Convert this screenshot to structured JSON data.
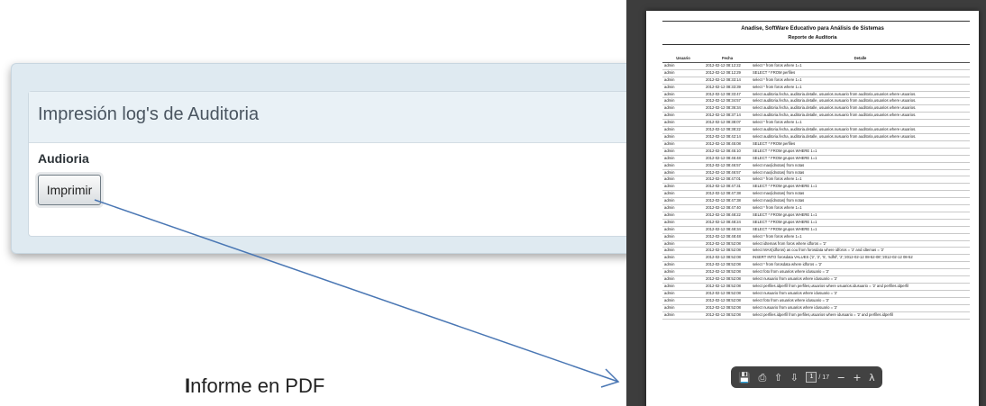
{
  "app": {
    "title": "Impresión log's de Auditoria",
    "section_label": "Audioria",
    "print_button": "Imprimir"
  },
  "caption": {
    "first_letter": "I",
    "rest": "nforme en PDF"
  },
  "pdf": {
    "title": "Anadise, SoftWare Educativo para Análisis de Sistemas",
    "subtitle": "Reporte de Auditoria",
    "columns": [
      "Usuario",
      "Fecha",
      "Detalle"
    ],
    "rows": [
      [
        "admin",
        "2012-02-12 08:12:22",
        "select * from foros where 1=1"
      ],
      [
        "admin",
        "2012-02-12 08:12:29",
        "SELECT * FROM perfiles"
      ],
      [
        "admin",
        "2012-02-12 08:33:14",
        "select * from foros where 1=1"
      ],
      [
        "admin",
        "2012-02-12 08:33:39",
        "select * from foros where 1=1"
      ],
      [
        "admin",
        "2012-02-12 08:33:47",
        "select auditoria.fecha, auditoria.detalle, usuarios.nusuario from auditoria,usuarios where usuarios."
      ],
      [
        "admin",
        "2012-02-12 08:34:57",
        "select auditoria.fecha, auditoria.detalle, usuarios.nusuario from auditoria,usuarios where usuarios."
      ],
      [
        "admin",
        "2012-02-12 08:36:34",
        "select auditoria.fecha, auditoria.detalle, usuarios.nusuario from auditoria,usuarios where usuarios."
      ],
      [
        "admin",
        "2012-02-12 08:37:14",
        "select auditoria.fecha, auditoria.detalle, usuarios.nusuario from auditoria,usuarios where usuarios."
      ],
      [
        "admin",
        "2012-02-12 08:38:07",
        "select * from foros where 1=1"
      ],
      [
        "admin",
        "2012-02-12 08:38:22",
        "select auditoria.fecha, auditoria.detalle, usuarios.nusuario from auditoria,usuarios where usuarios."
      ],
      [
        "admin",
        "2012-02-12 08:42:14",
        "select auditoria.fecha, auditoria.detalle, usuarios.nusuario from auditoria,usuarios where usuarios."
      ],
      [
        "admin",
        "2012-02-12 08:45:08",
        "SELECT * FROM perfiles"
      ],
      [
        "admin",
        "2012-02-12 08:45:10",
        "SELECT * FROM grupos WHERE 1=1"
      ],
      [
        "admin",
        "2012-02-12 08:46:48",
        "SELECT * FROM grupos WHERE 1=1"
      ],
      [
        "admin",
        "2012-02-12 08:46:57",
        "select max(idnotas) from notas"
      ],
      [
        "admin",
        "2012-02-12 08:46:57",
        "select max(idnotas) from notas"
      ],
      [
        "admin",
        "2012-02-12 08:47:01",
        "select * from foros where 1=1"
      ],
      [
        "admin",
        "2012-02-12 08:47:31",
        "SELECT * FROM grupos WHERE 1=1"
      ],
      [
        "admin",
        "2012-02-12 08:47:38",
        "select max(idnotas) from notas"
      ],
      [
        "admin",
        "2012-02-12 08:47:38",
        "select max(idnotas) from notas"
      ],
      [
        "admin",
        "2012-02-12 08:47:40",
        "select * from foros where 1=1"
      ],
      [
        "admin",
        "2012-02-12 08:48:22",
        "SELECT * FROM grupos WHERE 1=1"
      ],
      [
        "admin",
        "2012-02-12 08:48:24",
        "SELECT * FROM grupos WHERE 1=1"
      ],
      [
        "admin",
        "2012-02-12 08:48:34",
        "SELECT * FROM grupos WHERE 1=1"
      ],
      [
        "admin",
        "2012-02-12 08:48:48",
        "select * from foros where 1=1"
      ],
      [
        "admin",
        "2012-02-12 08:52:08",
        "select idtemas from foros where idforos = '2'"
      ],
      [
        "admin",
        "2012-02-12 08:52:08",
        "select MAX(idforos) as cou from forosdata where idforos = '2' and idtemas = '2'"
      ],
      [
        "admin",
        "2012-02-12 08:52:08",
        "INSERT INTO forosdata VALUES ('2', '2', '5', 'sdfsf', '2','2012-02-12 08-52-08','2012-02-12 08-52"
      ],
      [
        "admin",
        "2012-02-12 08:52:08",
        "select * from forosdata where idforos = '2'"
      ],
      [
        "admin",
        "2012-02-12 08:52:08",
        "select foto from usuarios where idusuario = '2'"
      ],
      [
        "admin",
        "2012-02-12 08:52:08",
        "select nusuario from usuarios where idusuario = '2'"
      ],
      [
        "admin",
        "2012-02-12 08:52:08",
        "select perfiles.idperfil from perfiles,usuarios where usuarios.idusuario = '2' and perfiles.idperfil"
      ],
      [
        "admin",
        "2012-02-12 08:52:08",
        "select nusuario from usuarios where idusuario = '2'"
      ],
      [
        "admin",
        "2012-02-12 08:52:08",
        "select foto from usuarios where idusuario = '2'"
      ],
      [
        "admin",
        "2012-02-12 08:52:08",
        "select nusuario from usuarios where idusuario = '2'"
      ],
      [
        "admin",
        "2012-02-12 08:52:08",
        "select perfiles.idperfil from perfiles,usuarios where idusuario = '2' and perfiles.idperfil"
      ]
    ],
    "toolbar": {
      "icons": [
        "save-icon",
        "print-icon",
        "prev-page-icon",
        "next-page-icon",
        "zoom-out-icon",
        "zoom-in-icon",
        "adobe-icon"
      ],
      "page_current": "1",
      "page_total": "/ 17"
    }
  },
  "colors": {
    "panel_bg": "#dfeaf1",
    "arrow": "#4a77b4",
    "pdf_bg": "#3d3d3d"
  }
}
